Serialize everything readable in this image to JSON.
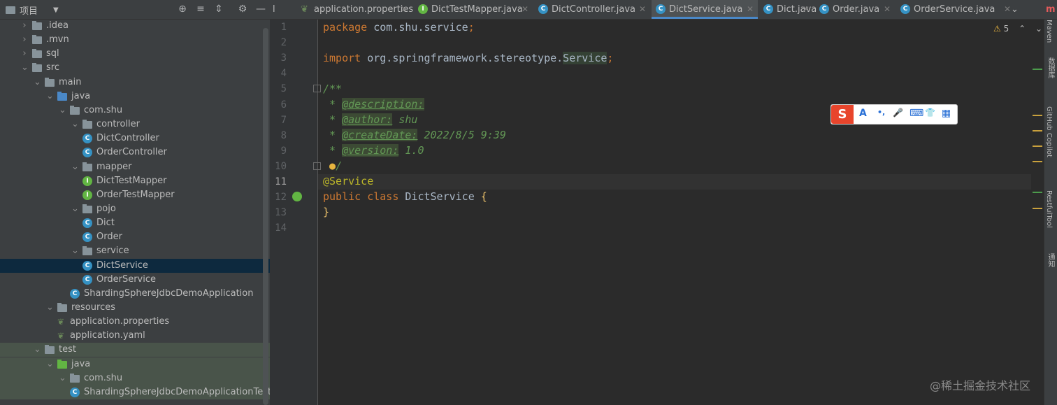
{
  "project_panel": {
    "title": "项目",
    "tree": [
      {
        "label": ".idea",
        "type": "folder",
        "depth": 0,
        "expanded": false
      },
      {
        "label": ".mvn",
        "type": "folder",
        "depth": 0,
        "expanded": false
      },
      {
        "label": "sql",
        "type": "folder",
        "depth": 0,
        "expanded": false
      },
      {
        "label": "src",
        "type": "folder",
        "depth": 0,
        "expanded": true
      },
      {
        "label": "main",
        "type": "folder",
        "depth": 1,
        "expanded": true
      },
      {
        "label": "java",
        "type": "folder-blue",
        "depth": 2,
        "expanded": true
      },
      {
        "label": "com.shu",
        "type": "package",
        "depth": 3,
        "expanded": true
      },
      {
        "label": "controller",
        "type": "package",
        "depth": 4,
        "expanded": true
      },
      {
        "label": "DictController",
        "type": "class",
        "depth": 5
      },
      {
        "label": "OrderController",
        "type": "class",
        "depth": 5
      },
      {
        "label": "mapper",
        "type": "package",
        "depth": 4,
        "expanded": true
      },
      {
        "label": "DictTestMapper",
        "type": "interface",
        "depth": 5
      },
      {
        "label": "OrderTestMapper",
        "type": "interface",
        "depth": 5
      },
      {
        "label": "pojo",
        "type": "package",
        "depth": 4,
        "expanded": true
      },
      {
        "label": "Dict",
        "type": "class",
        "depth": 5
      },
      {
        "label": "Order",
        "type": "class",
        "depth": 5
      },
      {
        "label": "service",
        "type": "package",
        "depth": 4,
        "expanded": true
      },
      {
        "label": "DictService",
        "type": "class",
        "depth": 5,
        "selected": true
      },
      {
        "label": "OrderService",
        "type": "class",
        "depth": 5
      },
      {
        "label": "ShardingSphereJdbcDemoApplication",
        "type": "spring-class",
        "depth": 4
      },
      {
        "label": "resources",
        "type": "folder",
        "depth": 2,
        "expanded": true
      },
      {
        "label": "application.properties",
        "type": "spring-leaf",
        "depth": 3
      },
      {
        "label": "application.yaml",
        "type": "spring-leaf",
        "depth": 3
      },
      {
        "label": "test",
        "type": "folder",
        "depth": 1,
        "expanded": true
      },
      {
        "label": "java",
        "type": "folder-green",
        "depth": 2,
        "expanded": true
      },
      {
        "label": "com.shu",
        "type": "package",
        "depth": 3,
        "expanded": true
      },
      {
        "label": "ShardingSphereJdbcDemoApplicationTests",
        "type": "spring-class",
        "depth": 4
      }
    ]
  },
  "tabs": [
    {
      "label": "application.properties",
      "icon": "spring"
    },
    {
      "label": "DictTestMapper.java",
      "icon": "interface"
    },
    {
      "label": "DictController.java",
      "icon": "class"
    },
    {
      "label": "DictService.java",
      "icon": "class",
      "active": true
    },
    {
      "label": "Dict.java",
      "icon": "class"
    },
    {
      "label": "Order.java",
      "icon": "class"
    },
    {
      "label": "OrderService.java",
      "icon": "class"
    }
  ],
  "tab_overflow_prefix": "l",
  "editor": {
    "warnings_count": "5",
    "line_numbers": [
      "1",
      "2",
      "3",
      "4",
      "5",
      "6",
      "7",
      "8",
      "9",
      "10",
      "11",
      "12",
      "13",
      "14"
    ],
    "current_line": "11"
  },
  "right_strip": [
    "Maven",
    "数据库",
    "GitHub Copilot",
    "RestfulTool",
    "通知"
  ],
  "ime_toolbar": {
    "logo": "S",
    "glyphs": [
      "A",
      "•,",
      "🎤",
      "⌨",
      "👕",
      "▦"
    ]
  },
  "watermark": "@稀土掘金技术社区",
  "colors": {
    "accent": "#4a88c7",
    "selection": "#0d293e",
    "keyword": "#cc7832",
    "annotation": "#bbb529",
    "comment": "#629755"
  }
}
